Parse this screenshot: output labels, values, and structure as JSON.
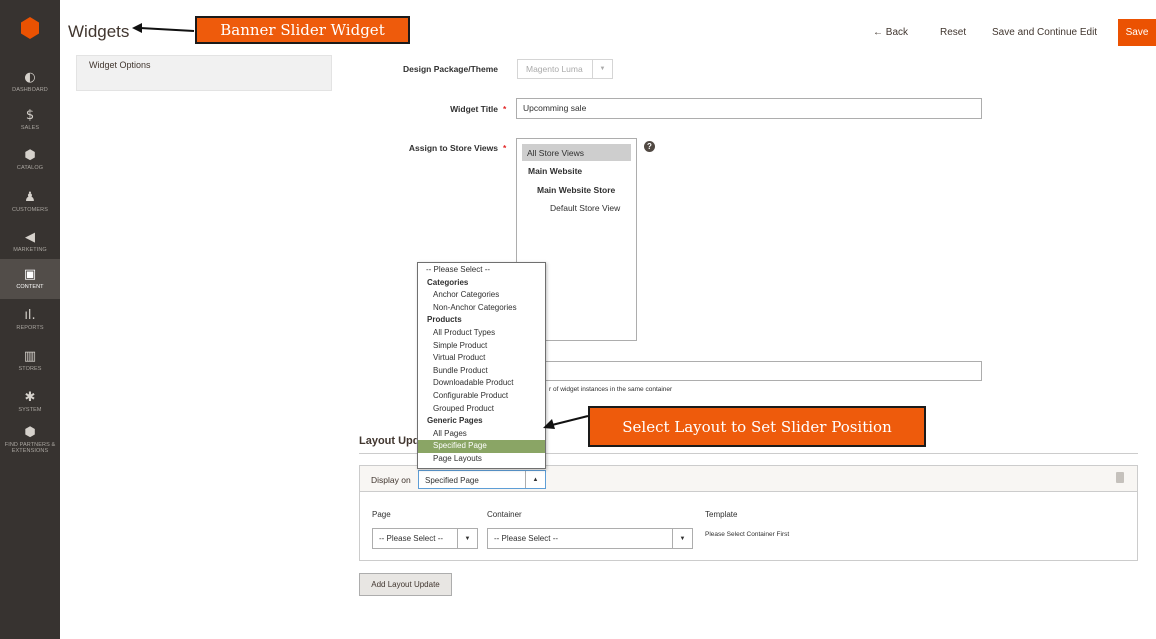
{
  "nav": {
    "items": [
      {
        "icon": "dashboard-icon",
        "glyph": "◐",
        "label": "DASHBOARD"
      },
      {
        "icon": "dollar-icon",
        "glyph": "$",
        "label": "SALES"
      },
      {
        "icon": "catalog-cube-icon",
        "glyph": "⬢",
        "label": "CATALOG"
      },
      {
        "icon": "customer-icon",
        "glyph": "♟",
        "label": "CUSTOMERS"
      },
      {
        "icon": "megaphone-icon",
        "glyph": "◀",
        "label": "MARKETING"
      },
      {
        "icon": "content-icon",
        "glyph": "▣",
        "label": "CONTENT"
      },
      {
        "icon": "reports-bar-icon",
        "glyph": "ıl.",
        "label": "REPORTS"
      },
      {
        "icon": "store-icon",
        "glyph": "▥",
        "label": "STORES"
      },
      {
        "icon": "gear-icon",
        "glyph": "✱",
        "label": "SYSTEM"
      },
      {
        "icon": "partners-cube-icon",
        "glyph": "⬢",
        "label": "FIND PARTNERS & EXTENSIONS"
      }
    ]
  },
  "header": {
    "title": "Widgets",
    "back_label": "← Back",
    "reset_label": "Reset",
    "save_continue_label": "Save and Continue Edit",
    "save_label": "Save"
  },
  "left_panel": {
    "title": "Widget Options"
  },
  "form": {
    "design_label": "Design Package/Theme",
    "design_value": "Magento Luma",
    "title_label": "Widget Title",
    "title_value": "Upcomming sale",
    "store_label": "Assign to Store Views",
    "store_options": [
      "All Store Views",
      "Main Website",
      "Main Website Store",
      "Default Store View"
    ],
    "required_mark": "*",
    "help_glyph": "?",
    "note": "r of widget instances in the same container"
  },
  "layout_updates": {
    "section_title": "Layout Upda",
    "display_on_label": "Display on",
    "display_on_value": "Specified Page",
    "page_label": "Page",
    "page_value": "-- Please Select --",
    "container_label": "Container",
    "container_value": "-- Please Select --",
    "template_label": "Template",
    "template_value": "Please Select Container First",
    "add_button": "Add Layout Update"
  },
  "dropdown": {
    "options": [
      {
        "label": "-- Please Select --",
        "kind": "top"
      },
      {
        "label": "Categories",
        "kind": "group"
      },
      {
        "label": "Anchor Categories",
        "kind": "sub"
      },
      {
        "label": "Non-Anchor Categories",
        "kind": "sub"
      },
      {
        "label": "Products",
        "kind": "group"
      },
      {
        "label": "All Product Types",
        "kind": "sub"
      },
      {
        "label": "Simple Product",
        "kind": "sub"
      },
      {
        "label": "Virtual Product",
        "kind": "sub"
      },
      {
        "label": "Bundle Product",
        "kind": "sub"
      },
      {
        "label": "Downloadable Product",
        "kind": "sub"
      },
      {
        "label": "Configurable Product",
        "kind": "sub"
      },
      {
        "label": "Grouped Product",
        "kind": "sub"
      },
      {
        "label": "Generic Pages",
        "kind": "group"
      },
      {
        "label": "All Pages",
        "kind": "sub"
      },
      {
        "label": "Specified Page",
        "kind": "sub-hl"
      },
      {
        "label": "Page Layouts",
        "kind": "sub"
      }
    ]
  },
  "callouts": {
    "banner": "Banner Slider Widget",
    "layout": "Select Layout to Set Slider Position"
  },
  "colors": {
    "accent": "#eb5202",
    "sidebar": "#373330",
    "callout": "#ee5b0c",
    "highlight": "#8aa565"
  }
}
